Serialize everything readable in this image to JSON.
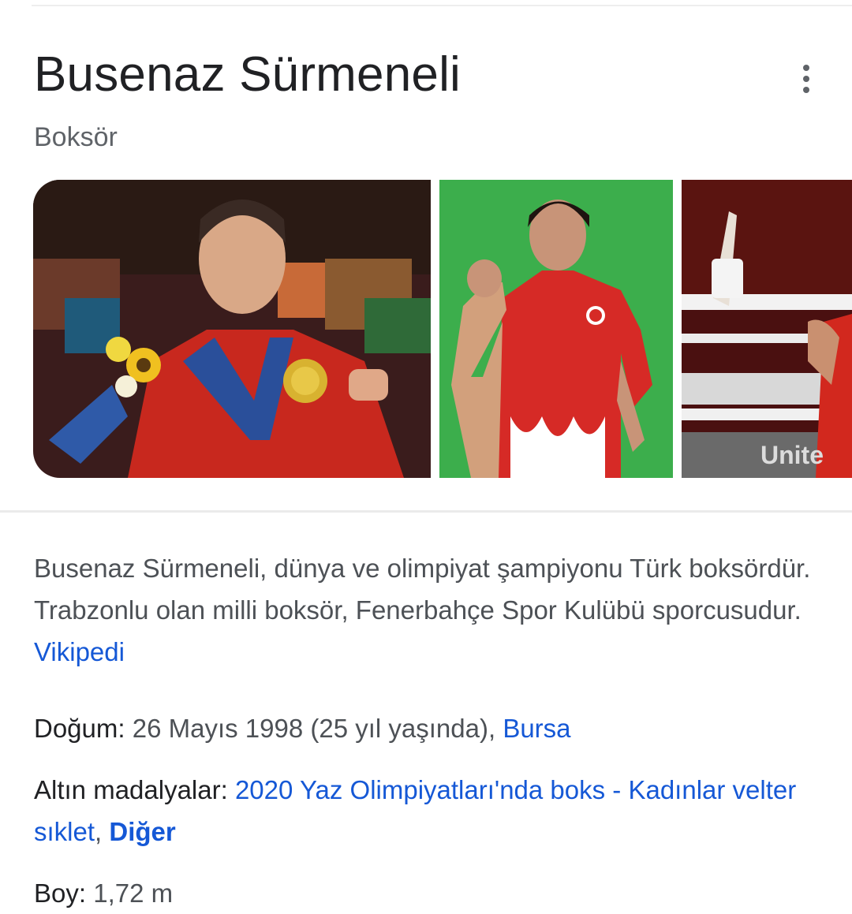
{
  "header": {
    "title": "Busenaz Sürmeneli",
    "subtitle": "Boksör"
  },
  "colors": {
    "link": "#1558d6",
    "text_secondary": "#4d5156",
    "text_primary": "#202124",
    "muted": "#5f6368"
  },
  "gallery": {
    "images": [
      {
        "name": "photo-medal-ceremony",
        "icon": "photo-icon"
      },
      {
        "name": "photo-green-background",
        "icon": "photo-icon"
      },
      {
        "name": "photo-ring-victory",
        "icon": "photo-icon"
      }
    ],
    "photo3_banner_text": "Unite"
  },
  "description": {
    "text": "Busenaz Sürmeneli, dünya ve olimpiyat şampiyonu Türk boksördür. Trabzonlu olan milli boksör, Fenerbahçe Spor Kulübü sporcusudur. ",
    "source_link": "Vikipedi"
  },
  "facts": {
    "birth": {
      "label": "Doğum",
      "value": "26 Mayıs 1998 (25 yıl yaşında), ",
      "link": "Bursa"
    },
    "medals": {
      "label": "Altın madalyalar",
      "link": "2020 Yaz Olimpiyatları'nda boks - Kadınlar velter sıklet",
      "separator": ", ",
      "more_link": "Diğer"
    },
    "height": {
      "label": "Boy",
      "value": "1,72 m"
    }
  }
}
